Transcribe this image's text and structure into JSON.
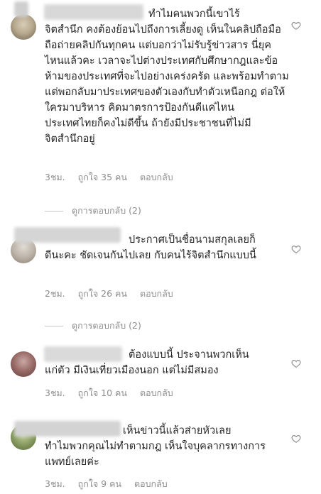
{
  "comments": [
    {
      "first_line": "ทำไมคนพวกนี้เขาไร้",
      "text": "จิตสำนึก คงต้องย้อนไปถึงการเลี้ยงดู เห็นในคลิปถือมือถือถ่ายคลิปกันทุกคน แต่บอกว่าไม่รับรู้ข่าวสาร นี่ยุคไหนแล้วคะ เวลาจะไปต่างประเทศกับศึกษากฎและข้อห้ามของประเทศที่จะไปอย่างเคร่งครัด และพร้อมทำตาม แต่พอกลับมาประเทศของตัวเองกับทำตัวเหนือกฎ ต่อให้ใครมาบริหาร คิดมาตรการป้องกันดีแค่ไหน ประเทศไทยก็คงไม่ดีขึ้น ถ้ายังมีประชาชนที่ไม่มีจิตสำนึกอยู่",
      "time": "3ชม.",
      "likes": "ถูกใจ 35 คน",
      "reply_label": "ตอบกลับ",
      "view_replies": "ดูการตอบกลับ (2)"
    },
    {
      "first_line": "ประกาศเป็นชื่อนามสกุลเลยก็",
      "text": "ดีนะคะ ชัดเจนกันไปเลย กับคนไร้จิตสำนึกแบบนี้",
      "time": "2ชม.",
      "likes": "ถูกใจ 26 คน",
      "reply_label": "ตอบกลับ",
      "view_replies": "ดูการตอบกลับ (2)"
    },
    {
      "first_line": "ต้องแบบนี้ ประจานพวกเห็น",
      "text": "แก่ตัว มีเงินเที่ยวเมืองนอก แต่ไม่มีสมอง",
      "time": "3ชม.",
      "likes": "ถูกใจ 10 คน",
      "reply_label": "ตอบกลับ"
    },
    {
      "first_line": "เห็นข่าวนี้แล้วส่ายหัวเลย",
      "text": "ทำไมพวกคุณไม่ทำตามกฎ เห็นใจบุคลากรทางการแพทย์เลยค่ะ",
      "time": "3ชม.",
      "likes": "ถูกใจ 9 คน",
      "reply_label": "ตอบกลับ"
    }
  ],
  "colors": {
    "text": "#262626",
    "meta": "#8e8e8e",
    "heart_stroke": "#8e8e8e"
  },
  "icons": {
    "like": "heart-outline-icon"
  }
}
